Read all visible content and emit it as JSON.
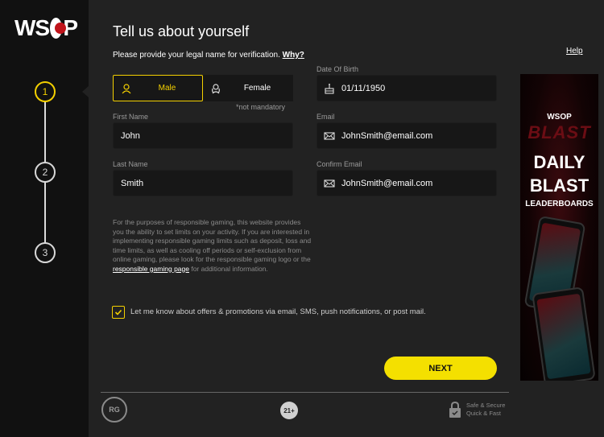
{
  "brand": {
    "logo_text": "WSOP"
  },
  "steps": [
    "1",
    "2",
    "3"
  ],
  "form": {
    "title": "Tell us about yourself",
    "subtitle": "Please provide your legal name for verification.",
    "why_link": "Why?",
    "help_link": "Help",
    "gender": {
      "options": [
        "Male",
        "Female"
      ],
      "selected": "Male",
      "note": "*not mandatory"
    },
    "dob": {
      "label": "Date Of Birth",
      "value": "01/11/1950"
    },
    "first_name": {
      "label": "First Name",
      "value": "John"
    },
    "last_name": {
      "label": "Last Name",
      "value": "Smith"
    },
    "email": {
      "label": "Email",
      "value": "JohnSmith@email.com"
    },
    "confirm_email": {
      "label": "Confirm Email",
      "value": "JohnSmith@email.com"
    },
    "disclaimer_pre": "For the purposes of responsible gaming, this website provides you the ability to set limits on your activity. If you are interested in implementing responsible gaming limits such as deposit, loss and time limits, as well as cooling off periods or self-exclusion from online gaming, please look for the responsible gaming logo or the ",
    "disclaimer_link": "responsible gaming page",
    "disclaimer_post": " for additional information.",
    "consent_label": "Let me know about offers & promotions via email, SMS, push notifications, or post mail.",
    "consent_checked": true,
    "next_label": "NEXT"
  },
  "footer": {
    "rg_badge": "RG",
    "age_badge": "21+",
    "secure_line1": "Safe & Secure",
    "secure_line2": "Quick & Fast"
  },
  "ad": {
    "logo": "WSOP",
    "blast": "BLAST",
    "daily": "DAILY",
    "blast2": "BLAST",
    "leaderboards": "LEADERBOARDS"
  },
  "colors": {
    "accent": "#f4d000",
    "button": "#f4e000",
    "sidebar": "#111111",
    "background": "#222222"
  }
}
